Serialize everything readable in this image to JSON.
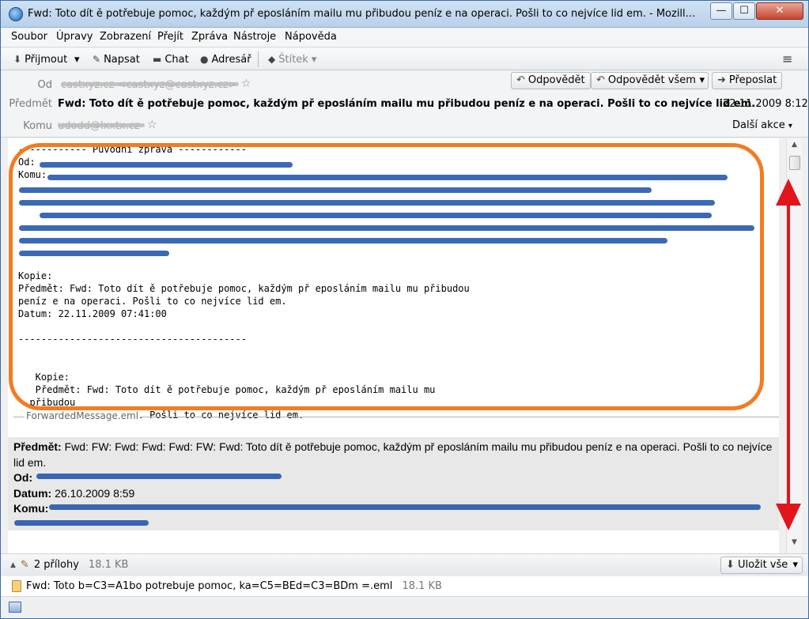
{
  "window": {
    "title": "Fwd: Toto dít ě potřebuje pomoc, každým př eposláním mailu mu přibudou peníz e na operaci. Pošli to co nejvíce lid em. - Mozilla Thunderbird",
    "min_glyph": "—",
    "max_glyph": "☐",
    "close_glyph": "✕"
  },
  "menu": [
    "Soubor",
    "Úpravy",
    "Zobrazení",
    "Přejít",
    "Zpráva",
    "Nástroje",
    "Nápověda"
  ],
  "toolbar": {
    "get_mail": "Přijmout",
    "write": "Napsat",
    "chat": "Chat",
    "address_book": "Adresář",
    "tag": "Štítek",
    "dropdown_glyph": "▾",
    "menu_glyph": "≡"
  },
  "header": {
    "from_label": "Od",
    "from_value": "castxyz.cz <castxyz@castxyz.cz>",
    "subject_label": "Předmět",
    "subject": "Fwd: Toto dít ě potřebuje pomoc, každým př eposláním mailu mu přibudou peníz e na operaci. Pošli to co nejvíce lid em.",
    "date": "22.11.2009 8:12",
    "to_label": "Komu",
    "to_value": "udodd@lxxtx.cz",
    "star_glyph": "☆",
    "reply": "Odpovědět",
    "reply_all": "Odpovědět všem",
    "forward": "Přeposlat",
    "more_actions": "Další akce"
  },
  "body": {
    "orig_header": "------------ Původní zpráva ------------",
    "od_prefix": "Od: ",
    "komu_prefix": "Komu: ",
    "kopie": "Kopie:",
    "predmet_line1": "Předmět: Fwd: Toto dít ě potřebuje pomoc, každým př eposláním mailu mu přibudou",
    "predmet_line2": "peníz e na operaci. Pošli to co nejvíce lid em.",
    "datum_line": "Datum: 22.11.2009 07:41:00",
    "divider": "----------------------------------------",
    "kopie2": "   Kopie:",
    "predmet2_line1": "   Předmět: Fwd: Toto dít ě potřebuje pomoc, každým př eposláním mailu mu",
    "predmet2_line2": "  přibudou",
    "predmet2_line3": "   peníz e na operaci. Pošli to co nejvíce lid em."
  },
  "forwarded": {
    "attachment_name": "ForwardedMessage.eml",
    "subject_label": "Předmět:",
    "subject": " Fwd: FW: Fwd: Fwd: Fwd: FW: Fwd: Toto dít ě potřebuje pomoc, každým př eposláním mailu mu přibudou peníz e na operaci. Pošli to co nejvíce lid em.",
    "from_label": "Od:",
    "date_label": "Datum:",
    "date": " 26.10.2009 8:59",
    "to_label": "Komu:"
  },
  "attachments": {
    "count_label": "2 přílohy",
    "total_size": "18.1 KB",
    "save_all": "Uložit vše",
    "file_name": "Fwd: Toto b=C3=A1bo potrebuje pomoc, ka=C5=BEd=C3=BDm =.eml",
    "file_size": "18.1 KB"
  },
  "colors": {
    "highlight_oval": "#f47b20",
    "arrow": "#e2141c",
    "scribble": "#1a4fa8"
  }
}
